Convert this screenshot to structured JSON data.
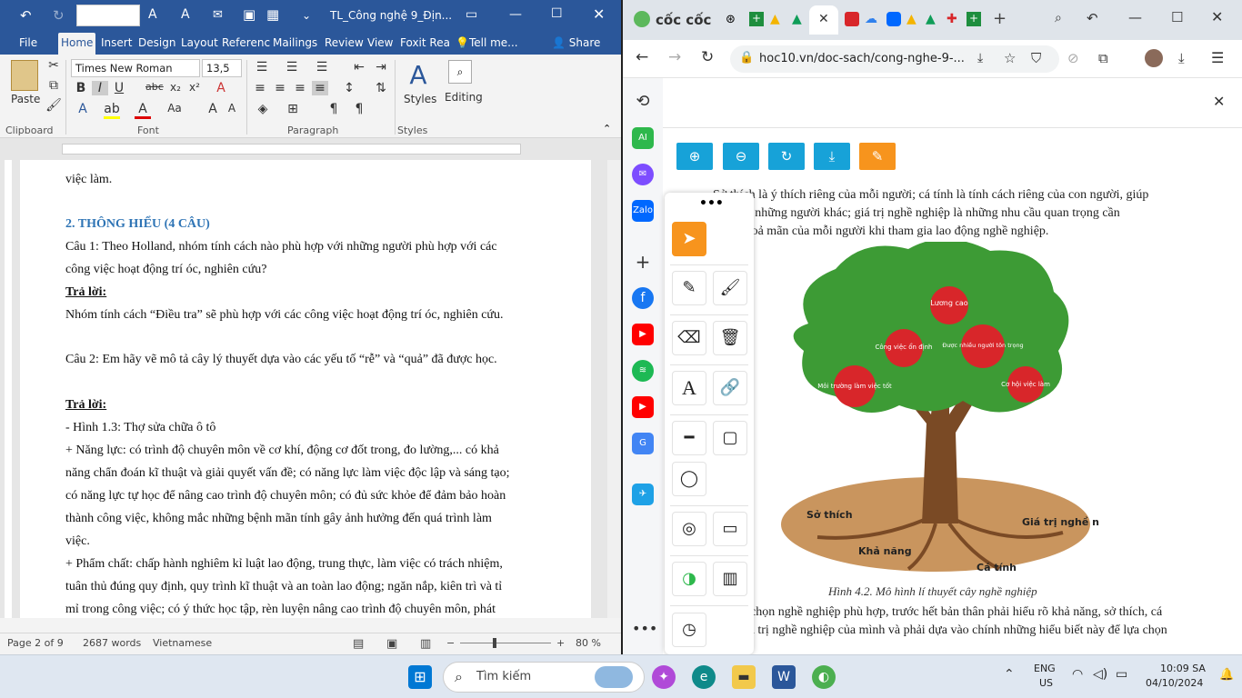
{
  "word": {
    "title": "TL_Công nghệ 9_Địn...",
    "font_size_box": "",
    "tabs": [
      "File",
      "Home",
      "Insert",
      "Design",
      "Layout",
      "Referenc",
      "Mailings",
      "Review",
      "View",
      "Foxit Rea",
      "Tell me...",
      "Share"
    ],
    "ribbon": {
      "paste": "Paste",
      "clipboard": "Clipboard",
      "font_name": "Times New Roman",
      "font_size": "13,5",
      "font": "Font",
      "paragraph": "Paragraph",
      "styles_btn": "Styles",
      "styles": "Styles",
      "editing": "Editing"
    },
    "lines": [
      "việc làm.",
      "2. THÔNG HIỂU (4 CÂU)",
      "Câu 1: Theo Holland, nhóm tính cách nào phù hợp với những người phù hợp với các",
      "công việc hoạt động trí óc, nghiên cứu?",
      "Trả lời:",
      "Nhóm tính cách “Điều tra” sẽ phù hợp với các công việc hoạt động trí óc, nghiên cứu.",
      "Câu 2: Em hãy vẽ mô tả cây lý thuyết dựa vào các yếu tố “rễ” và “quả” đã được học.",
      "Trả lời:",
      "- Hình 1.3: Thợ sửa chữa ô tô",
      "+ Năng lực: có trình độ chuyên môn về cơ khí, động cơ đốt trong, đo lường,... có khả",
      "năng chẩn đoán kĩ thuật và giải quyết vấn đề; có năng lực làm việc độc lập và sáng tạo;",
      "có năng lực tự học để nâng cao trình độ chuyên môn; có đủ sức khỏe để đảm bảo hoàn",
      "thành công việc, không mắc những bệnh mãn tính gây ảnh hưởng đến quá trình làm",
      "việc.",
      "+ Phẩm chất: chấp hành nghiêm kỉ luật lao động, trung thực, làm việc có trách nhiệm,",
      "tuân thủ đúng quy định, quy trình kĩ thuật và an toàn lao động; ngăn nắp, kiên trì và tỉ",
      "mỉ trong công việc; có ý thức học tập, rèn luyện nâng cao trình độ chuyên môn, phát"
    ],
    "status": {
      "page": "Page 2 of 9",
      "words": "2687 words",
      "lang": "Vietnamese",
      "zoom": "80 %"
    }
  },
  "browser": {
    "brand": "cốc cốc",
    "url": "hoc10.vn/doc-sach/cong-nghe-9-...",
    "book_text_top": [
      "Sở thích là ý thích riêng của mỗi người; cá tính là tính cách riêng của con người, giúp",
      "biệt với những người khác; giá trị nghề nghiệp là những nhu cầu quan trọng cần",
      "được thoả mãn của mỗi người khi tham gia lao động nghề nghiệp."
    ],
    "fruits": [
      "Lương cao",
      "Công việc ổn định",
      "Được nhiều người tôn trọng",
      "Môi trường làm việc tốt",
      "Cơ hội việc làm"
    ],
    "roots": [
      "Sở thích",
      "Giá trị nghề nghiệp",
      "Khả năng",
      "Cá tính"
    ],
    "caption": "Hình 4.2. Mô hình lí thuyết cây nghề nghiệp",
    "book_text_bottom": [
      "Để lựa chọn nghề nghiệp phù hợp, trước hết bản thân phải hiểu rõ khả năng, sở thích, cá",
      "tính, giá trị nghề nghiệp của mình và phải dựa vào chính những hiểu biết này để lựa chọn"
    ]
  },
  "taskbar": {
    "search": "Tìm kiếm",
    "lang1": "ENG",
    "lang2": "US",
    "time": "10:09 SA",
    "date": "04/10/2024"
  },
  "colors": {
    "word_blue": "#2b579a",
    "toolbar_blue": "#17a2d8",
    "toolbar_orange": "#f7941d",
    "tree_green": "#3d9b35",
    "apple_red": "#d8262a",
    "soil": "#c9955e"
  }
}
